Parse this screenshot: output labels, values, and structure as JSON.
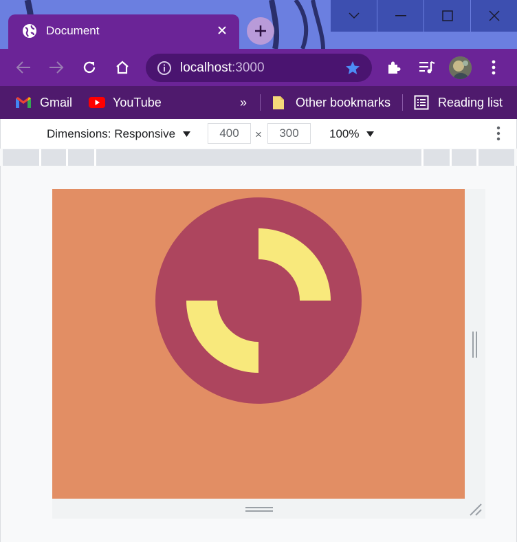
{
  "browser": {
    "tab": {
      "title": "Document",
      "favicon": "globe-icon"
    },
    "window_controls": [
      "chevron-down-icon",
      "minimize-icon",
      "maximize-icon",
      "close-icon"
    ],
    "toolbar": {
      "url_host": "localhost",
      "url_port": ":3000",
      "icons": [
        "back-icon",
        "forward-icon",
        "reload-icon",
        "home-icon",
        "info-icon",
        "star-icon",
        "extensions-icon",
        "media-icon",
        "avatar",
        "menu-icon"
      ]
    },
    "bookmarks": {
      "items": [
        {
          "label": "Gmail",
          "icon": "gmail-icon"
        },
        {
          "label": "YouTube",
          "icon": "youtube-icon"
        }
      ],
      "overflow": "»",
      "other": "Other bookmarks",
      "reading_list": "Reading list"
    }
  },
  "devtools": {
    "dimensions_label": "Dimensions: Responsive",
    "width": "400",
    "height": "300",
    "times": "×",
    "zoom": "100%"
  },
  "colors": {
    "page_background": "#e28e64",
    "circle": "#ad455e",
    "arcs": "#f8e97c",
    "tab_active": "#6b2497",
    "toolbar": "#6b2497",
    "bookmarks_bar": "#4f1a6d"
  }
}
